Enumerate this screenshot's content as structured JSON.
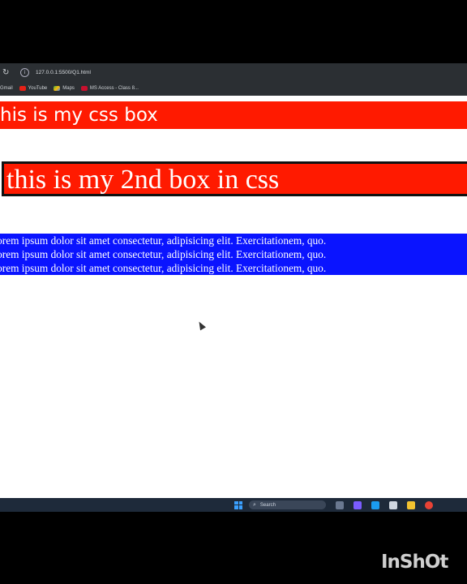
{
  "browser": {
    "url": "127.0.0.1:5500/Q1.html",
    "reload_icon": "reload-icon",
    "bookmarks": [
      {
        "label": "Gmail",
        "icon": "gmail-icon"
      },
      {
        "label": "YouTube",
        "icon": "youtube-icon"
      },
      {
        "label": "Maps",
        "icon": "maps-icon"
      },
      {
        "label": "MS Access - Class 8...",
        "icon": "ms-access-icon"
      }
    ]
  },
  "page": {
    "box1_text": "this is my css box",
    "box2_text": "this is my 2nd box in css",
    "box3_lines": [
      "Lorem ipsum dolor sit amet consectetur, adipisicing elit. Exercitationem, quo.",
      "Lorem ipsum dolor sit amet consectetur, adipisicing elit. Exercitationem, quo.",
      "Lorem ipsum dolor sit amet consectetur, adipisicing elit. Exercitationem, quo."
    ]
  },
  "taskbar": {
    "search_label": "Search"
  },
  "watermark": "InShOt",
  "colors": {
    "box_red": "#ff1a00",
    "box_blue": "#0a14ff",
    "chrome_dark": "#2b2f33"
  }
}
